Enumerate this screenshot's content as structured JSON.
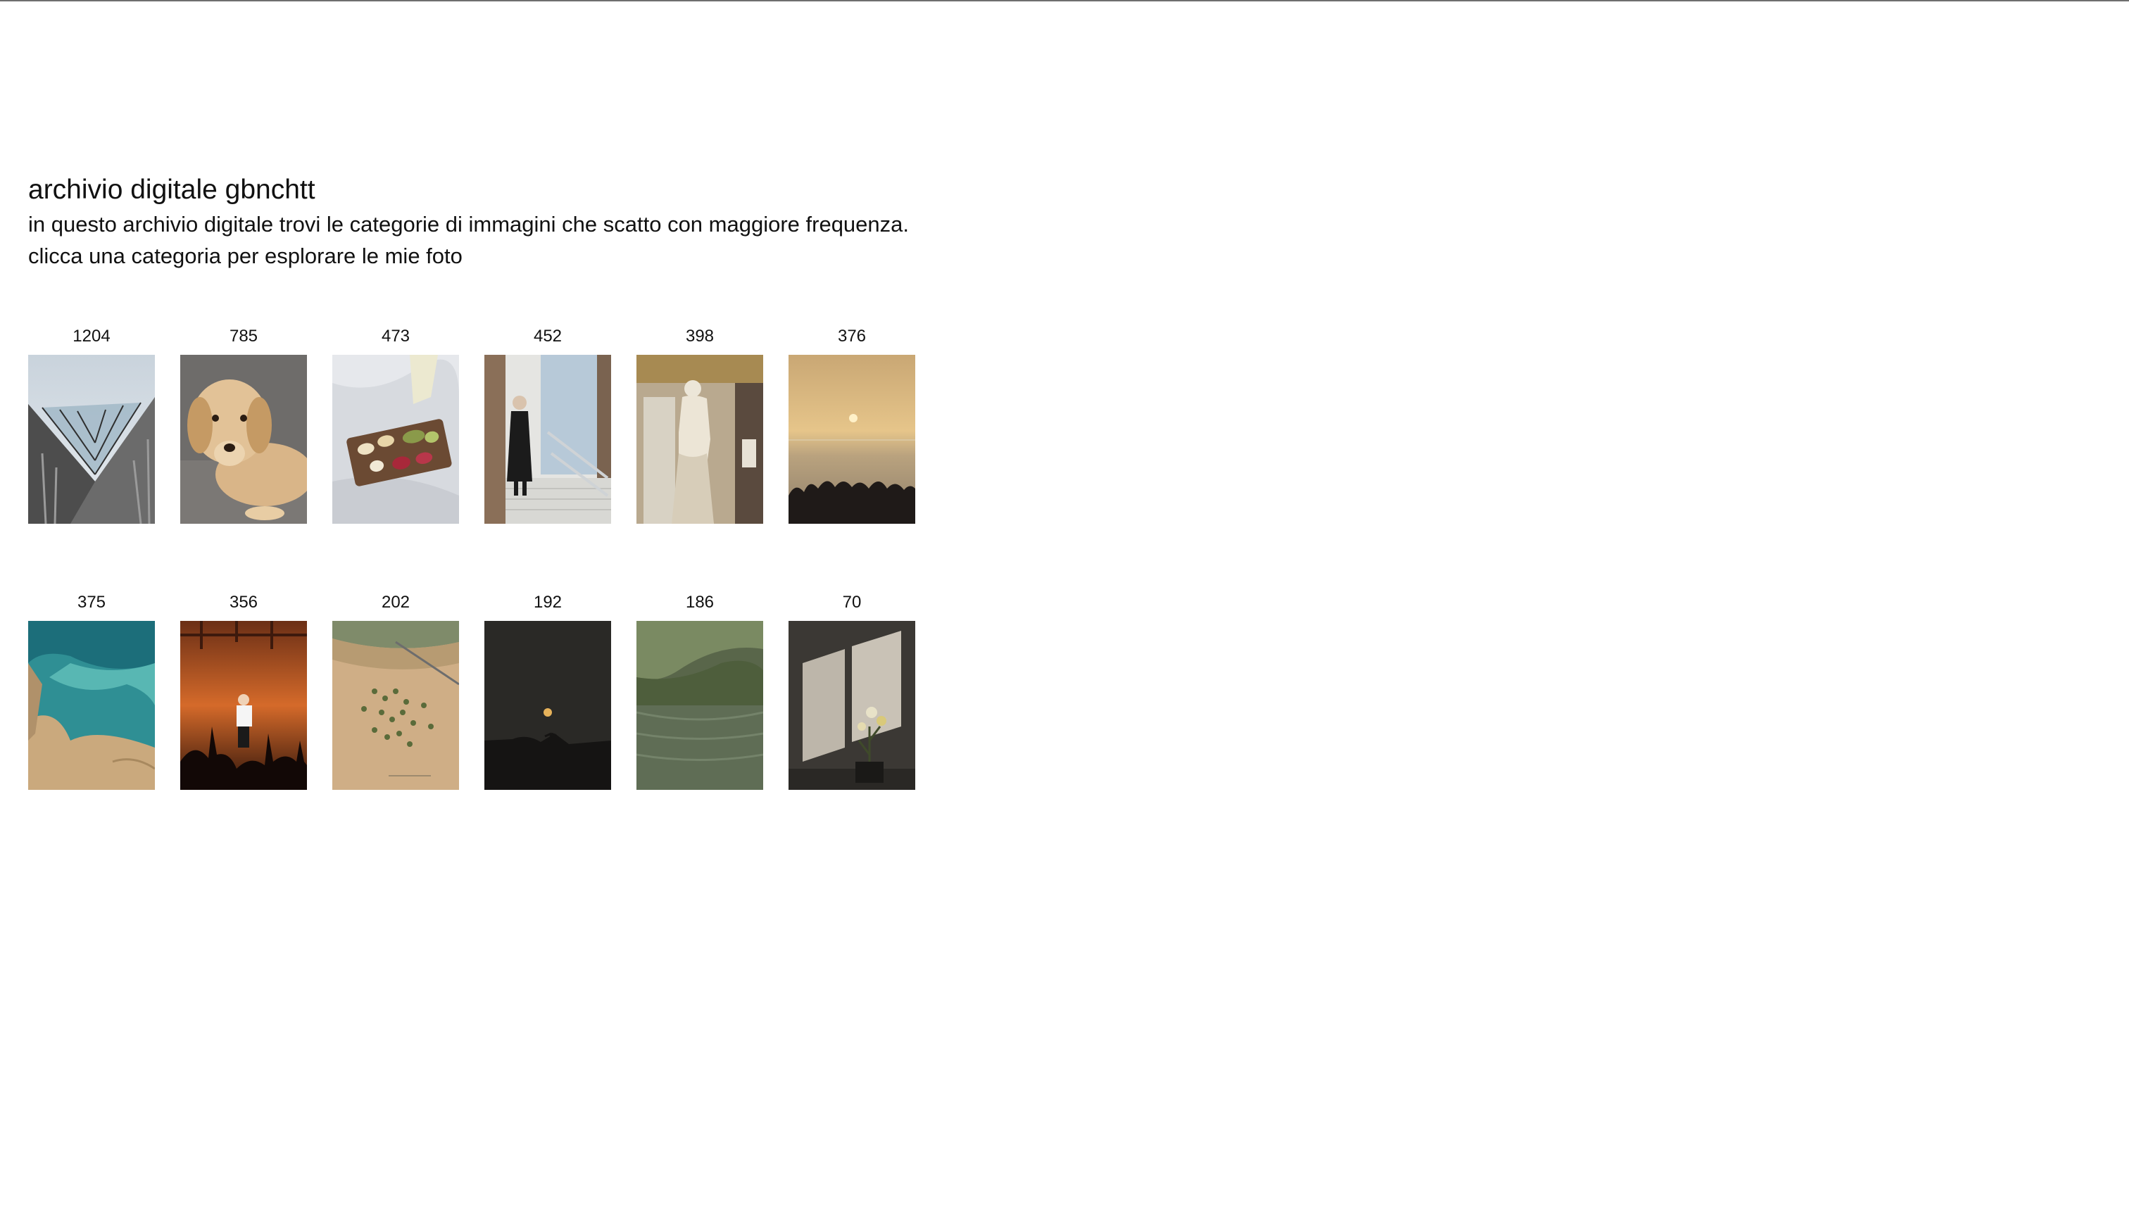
{
  "header": {
    "title": "archivio digitale gbnchtt",
    "line1": "in questo archivio digitale trovi le categorie di immagini che scatto con maggiore frequenza.",
    "line2": "clicca una categoria per esplorare le mie foto"
  },
  "categories": [
    {
      "count": "1204",
      "thumb": "architecture-glass-roof-photo"
    },
    {
      "count": "785",
      "thumb": "golden-retriever-photo"
    },
    {
      "count": "473",
      "thumb": "food-tray-on-sheets-photo"
    },
    {
      "count": "452",
      "thumb": "person-on-stairs-photo"
    },
    {
      "count": "398",
      "thumb": "marble-statue-museum-photo"
    },
    {
      "count": "376",
      "thumb": "sunset-over-sea-crowd-photo"
    },
    {
      "count": "375",
      "thumb": "turquoise-water-rocks-photo"
    },
    {
      "count": "356",
      "thumb": "concert-stage-orange-photo"
    },
    {
      "count": "202",
      "thumb": "aerial-landscape-trees-photo"
    },
    {
      "count": "192",
      "thumb": "moon-night-sky-photo"
    },
    {
      "count": "186",
      "thumb": "forest-lake-reflection-photo"
    },
    {
      "count": "70",
      "thumb": "window-shadow-flowers-photo"
    }
  ]
}
